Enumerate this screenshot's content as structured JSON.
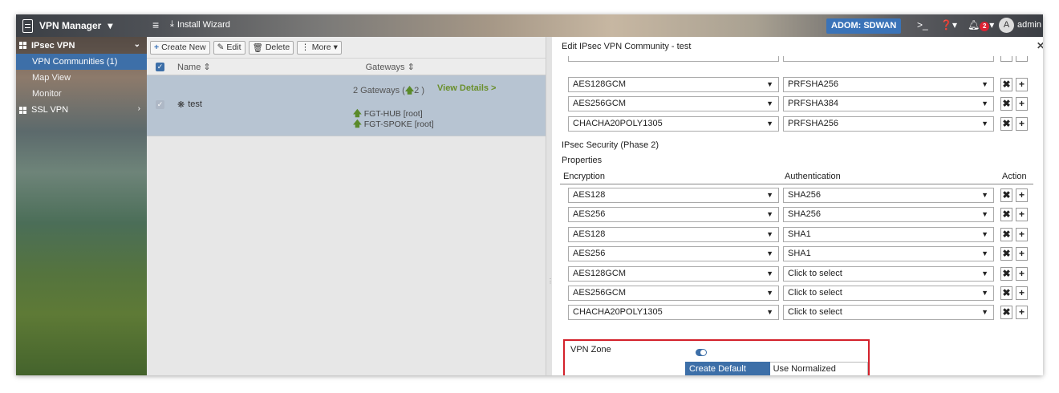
{
  "topbar": {
    "app_title": "VPN Manager",
    "install_wizard": "Install Wizard",
    "adom": "ADOM: SDWAN",
    "notif_count": "2",
    "avatar_letter": "A",
    "user": "admin"
  },
  "sidebar": {
    "ipsec_group": "IPsec VPN",
    "items": [
      {
        "label": "VPN Communities (1)",
        "active": true
      },
      {
        "label": "Map View",
        "active": false
      },
      {
        "label": "Monitor",
        "active": false
      }
    ],
    "ssl_group": "SSL VPN"
  },
  "toolbar": {
    "create_new": "Create New",
    "edit": "Edit",
    "delete": "Delete",
    "more": "More"
  },
  "table": {
    "col_name": "Name",
    "col_gateways": "Gateways",
    "row": {
      "name": "test",
      "gateway_count": "2 Gateways (",
      "gateway_count_num": "2",
      "gateway_count_close": ")",
      "view_details": "View Details >",
      "gateways": [
        "FGT-HUB [root]",
        "FGT-SPOKE [root]"
      ]
    }
  },
  "panel": {
    "title": "Edit IPsec VPN Community - test",
    "phase1_rows": [
      {
        "encryption": "AES128GCM",
        "authentication": "PRFSHA256"
      },
      {
        "encryption": "AES256GCM",
        "authentication": "PRFSHA384"
      },
      {
        "encryption": "CHACHA20POLY1305",
        "authentication": "PRFSHA256"
      }
    ],
    "phase2_title": "IPsec Security (Phase 2)",
    "properties_label": "Properties",
    "col_encryption": "Encryption",
    "col_authentication": "Authentication",
    "col_action": "Action",
    "phase2_rows": [
      {
        "encryption": "AES128",
        "authentication": "SHA256"
      },
      {
        "encryption": "AES256",
        "authentication": "SHA256"
      },
      {
        "encryption": "AES128",
        "authentication": "SHA1"
      },
      {
        "encryption": "AES256",
        "authentication": "SHA1"
      },
      {
        "encryption": "AES128GCM",
        "authentication": "Click to select"
      },
      {
        "encryption": "AES256GCM",
        "authentication": "Click to select"
      },
      {
        "encryption": "CHACHA20POLY1305",
        "authentication": "Click to select"
      }
    ],
    "vpn_zone_label": "VPN Zone",
    "vpn_zone_enabled": true,
    "zone_options": [
      "Create Default Zones",
      "Use Normalized Interface"
    ],
    "zone_selected": "Create Default Zones"
  },
  "colors": {
    "accent": "#3d6fa8",
    "highlight_border": "#d3212b",
    "view_details": "#6a8f2c"
  }
}
